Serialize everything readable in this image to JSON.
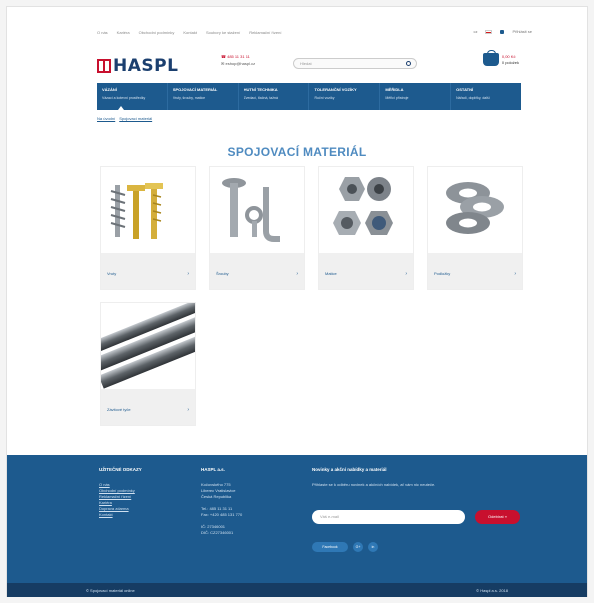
{
  "topnav": [
    "O nás",
    "Kariéra",
    "Obchodní podmínky",
    "Kontakt",
    "Soubory ke stažení",
    "Reklamační řízení"
  ],
  "toptools": {
    "lang": "cz",
    "login": "Přihlásit se"
  },
  "header": {
    "logo": "HASPL",
    "phone": "☎ 485 11 31 11",
    "email": "✉ eshop@haspl.cz",
    "search_placeholder": "Hledat",
    "cart_price": "0,00 Kč",
    "cart_items": "0 položek"
  },
  "catnav": [
    {
      "title": "VÁZÁNÍ",
      "sub": "Vázací a kotevní prostředky"
    },
    {
      "title": "SPOJOVACÍ MATERIÁL",
      "sub": "Vruty, šrouby, matice"
    },
    {
      "title": "HUTNÍ TECHNIKA",
      "sub": "Zvedací, tlačná, tažná"
    },
    {
      "title": "TOLERANČNÍ VOZÍKY",
      "sub": "Ruční vozíky"
    },
    {
      "title": "MĚŘIDLA",
      "sub": "Měřicí přístroje"
    },
    {
      "title": "OSTATNÍ",
      "sub": "Nářadí, doplňky, další"
    }
  ],
  "breadcrumb": [
    "Na úvodní",
    "Spojovací materiál"
  ],
  "page_title": "SPOJOVACÍ MATERIÁL",
  "products": [
    {
      "name": "Vruty"
    },
    {
      "name": "Šrouby"
    },
    {
      "name": "Matice"
    },
    {
      "name": "Podložky"
    },
    {
      "name": "Závitové tyče"
    }
  ],
  "footer": {
    "col1": {
      "heading": "UŽITEČNÉ ODKAZY",
      "links": [
        "O nás",
        "Obchodní podmínky",
        "Reklamační řízení",
        "Kariéra",
        "Doprava zdarma",
        "Kontakt"
      ]
    },
    "col2": {
      "heading": "HASPL a.s.",
      "lines": [
        "Kočovského 775",
        "Liberec Vratislavice",
        "Česká Republika",
        "",
        "Tel.: 485 11 31 11",
        "Fax: +420 485 131 770",
        "",
        "IČ: 27346001",
        "DIČ: CZ27346001"
      ]
    },
    "newsletter": {
      "heading": "Novinky a akční nabídky a materiál",
      "text": "Přihlaste se k odběru novinek a akčních nabídek, ať vám nic neuteče.",
      "placeholder": "Váš e-mail",
      "button": "Odebírat »"
    },
    "social": [
      "Facebook",
      "G+",
      "in"
    ]
  },
  "bottom": {
    "left": "© Spojovací materiál online",
    "right": "© Haspl a.s. 2018"
  }
}
